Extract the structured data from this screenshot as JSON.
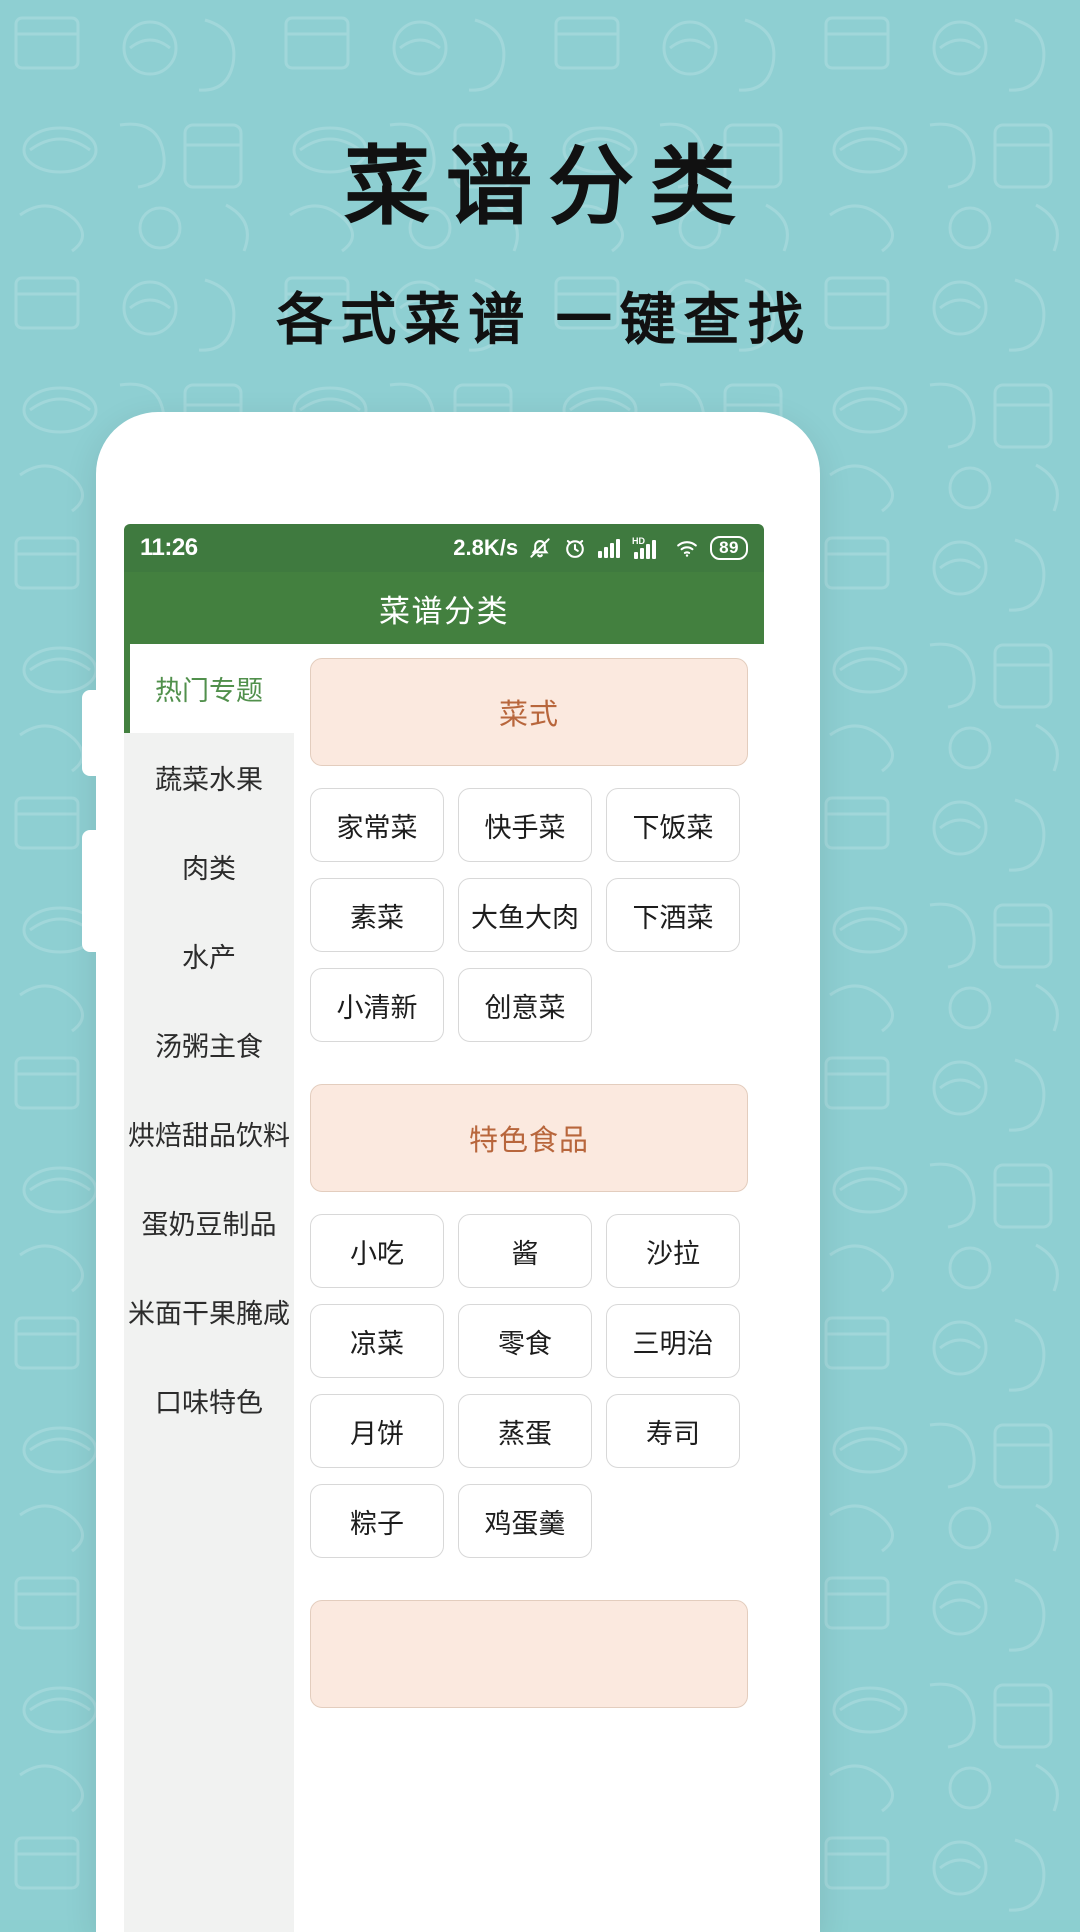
{
  "promo": {
    "title": "菜谱分类",
    "subtitle": "各式菜谱 一键查找",
    "bg_color": "#8ecfd2"
  },
  "statusbar": {
    "time": "11:26",
    "network_speed": "2.8K/s",
    "icons": [
      "mute-bell-icon",
      "alarm-clock-icon",
      "signal-bars-icon",
      "hd-signal-icon",
      "wifi-icon"
    ],
    "battery_level": "89",
    "bg_color": "#3f7a3f"
  },
  "appbar": {
    "title": "菜谱分类",
    "bg_color": "#43803f"
  },
  "sidebar": {
    "items": [
      {
        "label": "热门专题",
        "active": true
      },
      {
        "label": "蔬菜水果",
        "active": false
      },
      {
        "label": "肉类",
        "active": false
      },
      {
        "label": "水产",
        "active": false
      },
      {
        "label": "汤粥主食",
        "active": false
      },
      {
        "label": "烘焙甜品饮料",
        "active": false
      },
      {
        "label": "蛋奶豆制品",
        "active": false
      },
      {
        "label": "米面干果腌咸",
        "active": false
      },
      {
        "label": "口味特色",
        "active": false
      }
    ],
    "active_color": "#51904c",
    "bg_color": "#f1f2f1"
  },
  "main": {
    "sections": [
      {
        "header": "菜式",
        "items": [
          "家常菜",
          "快手菜",
          "下饭菜",
          "素菜",
          "大鱼大肉",
          "下酒菜",
          "小清新",
          "创意菜"
        ]
      },
      {
        "header": "特色食品",
        "items": [
          "小吃",
          "酱",
          "沙拉",
          "凉菜",
          "零食",
          "三明治",
          "月饼",
          "蒸蛋",
          "寿司",
          "粽子",
          "鸡蛋羹"
        ]
      },
      {
        "header": "",
        "items": []
      }
    ],
    "header_bg": "#fbe9df",
    "header_text_color": "#b8663c"
  }
}
